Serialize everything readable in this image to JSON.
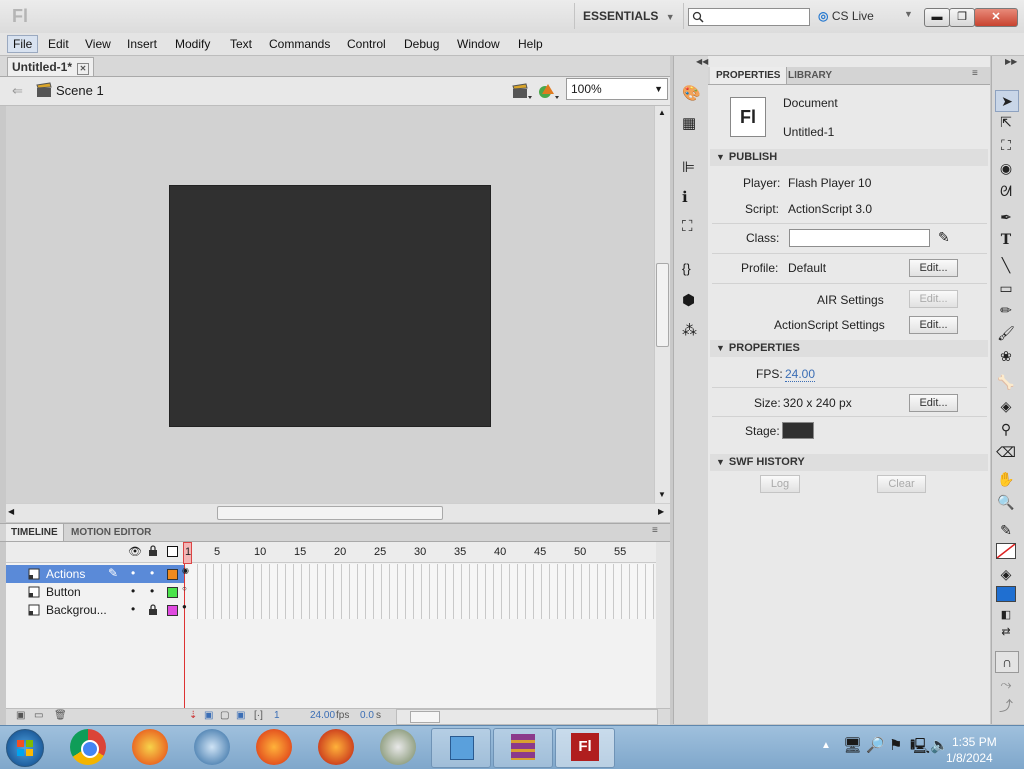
{
  "app": {
    "logo": "Fl"
  },
  "titlebar": {
    "workspace": "ESSENTIALS",
    "cslive": "CS Live",
    "search_placeholder": ""
  },
  "menu": [
    "File",
    "Edit",
    "View",
    "Insert",
    "Modify",
    "Text",
    "Commands",
    "Control",
    "Debug",
    "Window",
    "Help"
  ],
  "document": {
    "tab": "Untitled-1*",
    "scene": "Scene 1",
    "zoom": "100%"
  },
  "timeline": {
    "tabs": [
      "TIMELINE",
      "MOTION EDITOR"
    ],
    "frame_numbers": [
      "1",
      "5",
      "10",
      "15",
      "20",
      "25",
      "30",
      "35",
      "40",
      "45",
      "50",
      "55"
    ],
    "layers": [
      {
        "name": "Actions",
        "color": "#f08a1e",
        "selected": true
      },
      {
        "name": "Button",
        "color": "#4be34b",
        "selected": false
      },
      {
        "name": "Backgrou...",
        "color": "#e04be0",
        "selected": false
      }
    ],
    "status": {
      "frame": "1",
      "fps": "24.00",
      "fps_unit": "fps",
      "time": "0.0",
      "time_unit": "s"
    }
  },
  "properties": {
    "tabs": [
      "PROPERTIES",
      "LIBRARY"
    ],
    "doc_icon": "Fl",
    "doc_type": "Document",
    "doc_name": "Untitled-1",
    "publish_header": "PUBLISH",
    "player_label": "Player:",
    "player_value": "Flash Player 10",
    "script_label": "Script:",
    "script_value": "ActionScript 3.0",
    "class_label": "Class:",
    "class_value": "",
    "profile_label": "Profile:",
    "profile_value": "Default",
    "edit": "Edit...",
    "air_settings": "AIR Settings",
    "as_settings": "ActionScript Settings",
    "props_header": "PROPERTIES",
    "fps_label": "FPS:",
    "fps_value": "24.00",
    "size_label": "Size:",
    "size_value": "320 x 240 px",
    "stage_label": "Stage:",
    "stage_color": "#303030",
    "swf_header": "SWF HISTORY",
    "log": "Log",
    "clear": "Clear"
  },
  "taskbar": {
    "time": "1:35 PM",
    "date": "1/8/2024",
    "flash_label": "Fl"
  }
}
